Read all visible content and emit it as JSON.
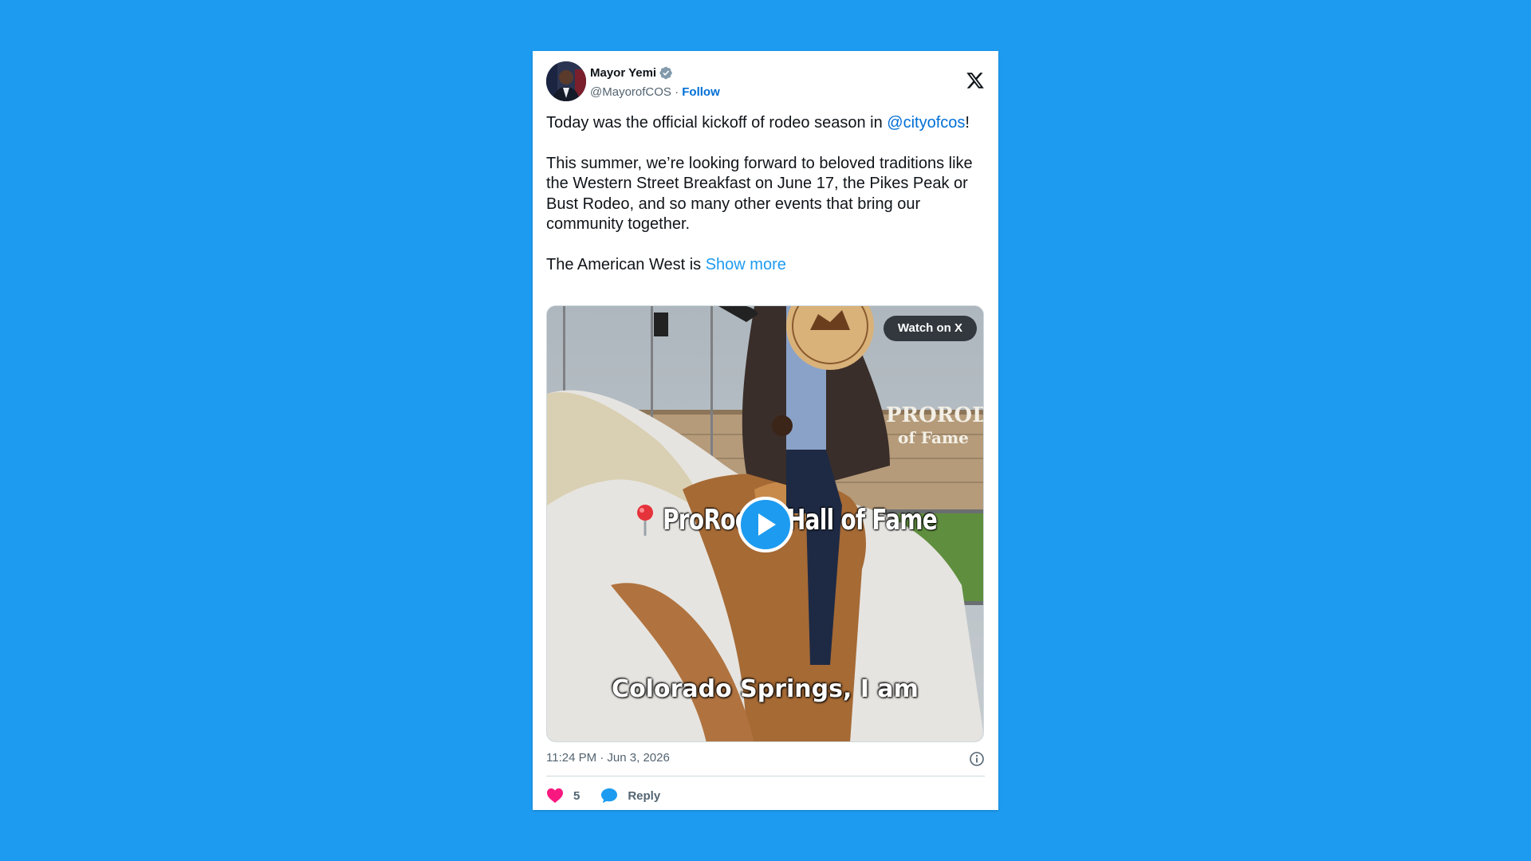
{
  "tweet": {
    "author": {
      "name": "Mayor Yemi",
      "handle": "@MayorofCOS",
      "separator": "·",
      "follow_label": "Follow",
      "verified_icon": "verified-badge-icon"
    },
    "logo_icon": "x-logo-icon",
    "text": {
      "p1_before": "Today was the official kickoff of rodeo season in ",
      "p1_mention": "@cityofcos",
      "p1_after": "!",
      "p2": "This summer, we’re looking forward to beloved traditions like the Western Street Breakfast on June 17, the Pikes Peak or Bust Rodeo, and so many other events that bring our community together.",
      "p3_before": "The American West is ",
      "show_more_label": "Show more"
    },
    "media": {
      "watch_label": "Watch on X",
      "caption_top": "ProRodeo Hall of Fame",
      "caption_bottom": "Colorado Springs, I am",
      "building_sign_1": "PRORODE",
      "building_sign_2": "of Fame",
      "play_icon": "play-icon"
    },
    "timestamp": "11:24 PM · Jun 3, 2026",
    "info_icon": "info-icon",
    "actions": {
      "like_count": "5",
      "reply_label": "Reply"
    }
  },
  "colors": {
    "background": "#1d9bf0",
    "link": "#006fd6",
    "like": "#f91880",
    "text": "#0f1419",
    "secondary": "#536471"
  }
}
